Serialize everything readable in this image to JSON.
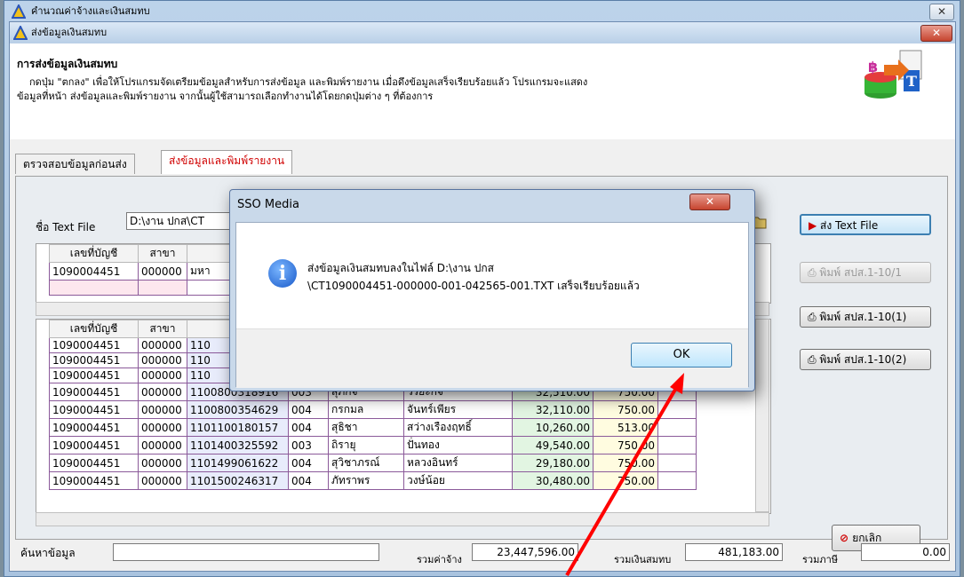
{
  "outer_window": {
    "title": "คำนวณค่าจ้างและเงินสมทบ",
    "close_glyph": "✕"
  },
  "inner_window": {
    "title": "ส่งข้อมูลเงินสมทบ",
    "close_glyph": "✕"
  },
  "header": {
    "heading": "การส่งข้อมูลเงินสมทบ",
    "desc_line1": "กดปุ่ม \"ตกลง\" เพื่อให้โปรแกรมจัดเตรียมข้อมูลสำหรับการส่งข้อมูล และพิมพ์รายงาน เมื่อดึงข้อมูลเสร็จเรียบร้อยแล้ว โปรแกรมจะแสดง",
    "desc_line2": "ข้อมูลที่หน้า ส่งข้อมูลและพิมพ์รายงาน จากนั้นผู้ใช้สามารถเลือกทำงานได้โดยกดปุ่มต่าง ๆ ที่ต้องการ"
  },
  "tabs": [
    {
      "label": "ตรวจสอบข้อมูลก่อนส่ง",
      "active": false
    },
    {
      "label": "ส่งข้อมูลและพิมพ์รายงาน",
      "active": true,
      "color": "#d00000"
    }
  ],
  "file": {
    "label": "ชื่อ Text File",
    "value": "D:\\งาน ปกส\\CT"
  },
  "buttons": {
    "send_text_file": "ส่ง Text File",
    "print_1": "พิมพ์ สปส.1-10/1",
    "print_2": "พิมพ์ สปส.1-10(1)",
    "print_3": "พิมพ์ สปส.1-10(2)",
    "cancel": "ยกเลิก"
  },
  "top_grid": {
    "headers": [
      "เลขที่บัญชี",
      "สาขา"
    ],
    "row": {
      "account": "1090004451",
      "branch": "000000",
      "name": "มหา"
    }
  },
  "bottom_grid": {
    "headers": [
      "เลขที่บัญชี",
      "สาขา",
      "เลข"
    ],
    "rows": [
      [
        "1090004451",
        "000000",
        "110",
        "",
        "",
        "",
        "",
        ""
      ],
      [
        "1090004451",
        "000000",
        "110",
        "",
        "",
        "",
        "",
        ""
      ],
      [
        "1090004451",
        "000000",
        "110",
        "",
        "",
        "",
        "",
        ""
      ],
      [
        "1090004451",
        "000000",
        "1100800318916",
        "003",
        "สุภกิจ",
        "วรยะกิจ",
        "32,510.00",
        "750.00"
      ],
      [
        "1090004451",
        "000000",
        "1100800354629",
        "004",
        "กรกมล",
        "จันทร์เพียร",
        "32,110.00",
        "750.00"
      ],
      [
        "1090004451",
        "000000",
        "1101100180157",
        "004",
        "สุธิชา",
        "สว่างเรืองฤทธิ์",
        "10,260.00",
        "513.00"
      ],
      [
        "1090004451",
        "000000",
        "1101400325592",
        "003",
        "ถิรายุ",
        "ปั่นทอง",
        "49,540.00",
        "750.00"
      ],
      [
        "1090004451",
        "000000",
        "1101499061622",
        "004",
        "สุวิชาภรณ์",
        "หลวงอินทร์",
        "29,180.00",
        "750.00"
      ],
      [
        "1090004451",
        "000000",
        "1101500246317",
        "004",
        "ภัทราพร",
        "วงษ์น้อย",
        "30,480.00",
        "750.00"
      ]
    ]
  },
  "footer": {
    "search_label": "ค้นหาข้อมูล",
    "wage_label": "รวมค่าจ้าง",
    "wage_total": "23,447,596.00",
    "contrib_label": "รวมเงินสมทบ",
    "contrib_total": "481,183.00",
    "tax_label": "รวมภาษี",
    "tax_total": "0.00"
  },
  "dialog": {
    "title": "SSO Media",
    "close_glyph": "✕",
    "message_line1": "ส่งข้อมูลเงินสมทบลงในไฟล์ D:\\งาน ปกส",
    "message_line2": "\\CT1090004451-000000-001-042565-001.TXT เสร็จเรียบร้อยแล้ว",
    "ok_label": "OK",
    "info_glyph": "i"
  },
  "colors": {
    "accent_red": "#d00000",
    "annotation_arrow": "#ff0000"
  }
}
